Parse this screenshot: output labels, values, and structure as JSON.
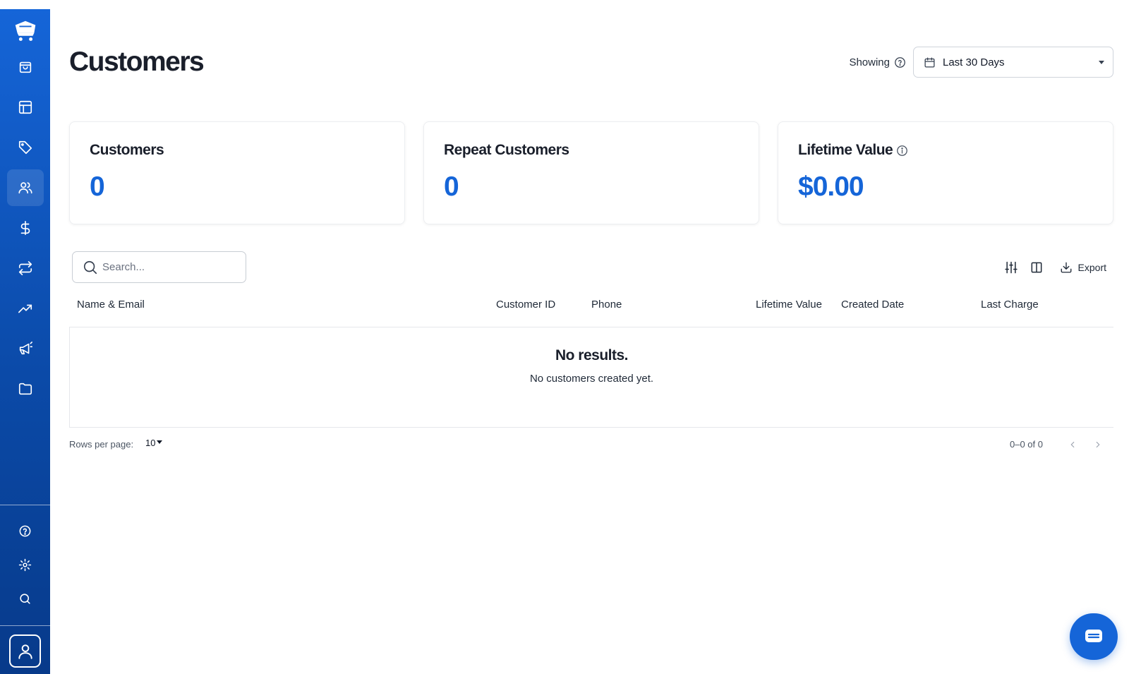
{
  "page": {
    "title": "Customers"
  },
  "filter": {
    "showing_label": "Showing",
    "date_range": "Last 30 Days"
  },
  "stats": [
    {
      "label": "Customers",
      "value": "0"
    },
    {
      "label": "Repeat Customers",
      "value": "0"
    },
    {
      "label": "Lifetime Value",
      "value": "$0.00"
    }
  ],
  "search": {
    "placeholder": "Search..."
  },
  "toolbar": {
    "export_label": "Export"
  },
  "table": {
    "columns": [
      "Name & Email",
      "Customer ID",
      "Phone",
      "Lifetime Value",
      "Created Date",
      "Last Charge"
    ],
    "empty_title": "No results.",
    "empty_subtitle": "No customers created yet."
  },
  "pagination": {
    "rows_per_page_label": "Rows per page:",
    "rows_per_page_value": "10",
    "range_text": "0–0 of 0"
  },
  "colors": {
    "accent": "#1565d8",
    "sidebar_top": "#1565d8",
    "sidebar_bottom": "#073a8a"
  },
  "icons": {
    "sidebar": [
      "logo-cart-icon",
      "shopping-bag-icon",
      "layout-icon",
      "tag-icon",
      "users-icon",
      "dollar-icon",
      "repeat-icon",
      "trending-up-icon",
      "megaphone-icon",
      "folder-icon"
    ],
    "sidebar_bottom": [
      "help-icon",
      "settings-icon",
      "search-icon",
      "user-profile-icon"
    ]
  }
}
